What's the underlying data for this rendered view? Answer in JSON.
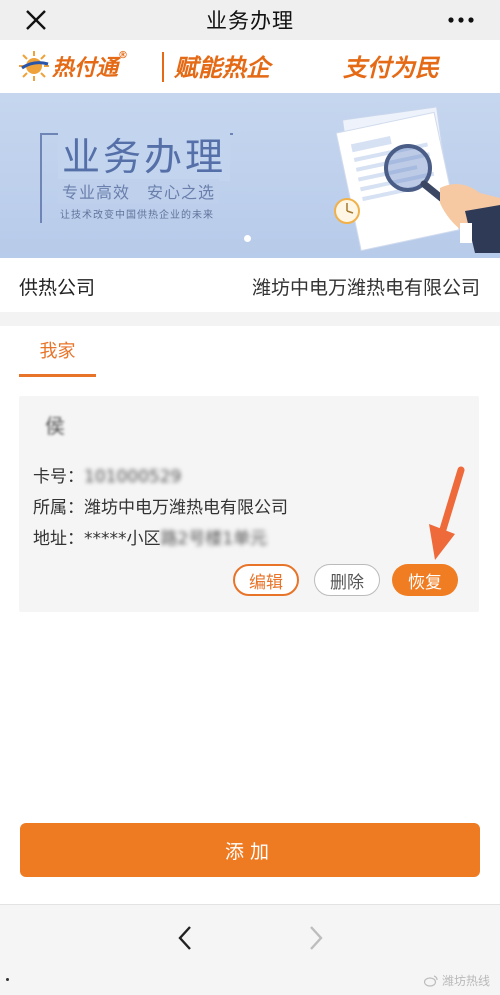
{
  "topbar": {
    "title": "业务办理",
    "close_icon": "close-icon",
    "more_icon": "more-dots-icon"
  },
  "brand": {
    "name": "热付通",
    "registered": "®",
    "slogan1": "赋能热企",
    "slogan2": "支付为民",
    "color": "#e56a16"
  },
  "banner": {
    "title": "业务办理",
    "subtitle": "专业高效　安心之选",
    "tagline": "让技术改变中国供热企业的未来",
    "slide_count": 2,
    "active_slide": 1
  },
  "company": {
    "label": "供热公司",
    "value": "潍坊中电万潍热电有限公司"
  },
  "tabs": [
    {
      "label": "我家",
      "active": true
    }
  ],
  "card": {
    "name": "侯",
    "card_no_label": "卡号：",
    "card_no_value": "101000529",
    "belong_label": "所属：",
    "belong_value": "潍坊中电万潍热电有限公司",
    "address_label": "地址：",
    "address_value_prefix": "*****小区",
    "address_value_blurred": "路2号楼1单元",
    "buttons": {
      "edit": "编辑",
      "delete": "删除",
      "restore": "恢复"
    }
  },
  "add_button": {
    "label": "添加"
  },
  "bottom_nav": {
    "back_icon": "chevron-left-icon",
    "forward_icon": "chevron-right-icon"
  },
  "watermark": {
    "text": "潍坊热线"
  },
  "colors": {
    "accent": "#ee7a22",
    "topbar_bg": "#efefef",
    "banner_bg": "#c6d6ef"
  }
}
